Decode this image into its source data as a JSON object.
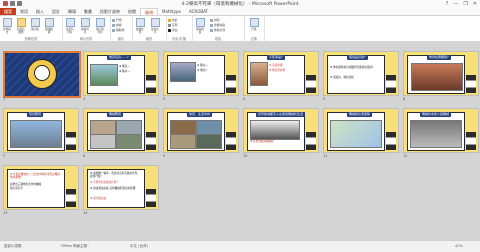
{
  "window": {
    "title": "4-2樂高不死車（環境和機械化） - Microsoft PowerPoint",
    "controls": [
      "?",
      "—",
      "❐",
      "✕"
    ]
  },
  "tabs": [
    {
      "label": "檔案",
      "kind": "file"
    },
    {
      "label": "常用",
      "kind": "normal"
    },
    {
      "label": "插入",
      "kind": "normal"
    },
    {
      "label": "設計",
      "kind": "normal"
    },
    {
      "label": "轉場",
      "kind": "normal"
    },
    {
      "label": "動畫",
      "kind": "normal"
    },
    {
      "label": "投影片放映",
      "kind": "normal"
    },
    {
      "label": "校閱",
      "kind": "normal"
    },
    {
      "label": "檢視",
      "kind": "active"
    },
    {
      "label": "Mathtype",
      "kind": "normal"
    },
    {
      "label": "ACROBAT",
      "kind": "normal"
    }
  ],
  "ribbon": {
    "groups": [
      {
        "label": "簡報檢視",
        "buttons": [
          "標準模式",
          "投影片瀏覽",
          "備忘稿",
          "閱讀檢視"
        ]
      },
      {
        "label": "母片檢視",
        "buttons": [
          "投影片母片",
          "講義母片",
          "備忘稿母片"
        ]
      },
      {
        "label": "顯示",
        "items": [
          "尺規",
          "格線",
          "輔助線"
        ]
      },
      {
        "label": "縮放",
        "buttons": [
          "縮放比例",
          "最適大小"
        ]
      },
      {
        "label": "色彩/灰階",
        "items": [
          "色彩",
          "灰階",
          "黑白"
        ]
      },
      {
        "label": "視窗",
        "buttons": [
          "開新視窗"
        ],
        "items": [
          "排列",
          "重疊視窗",
          "移動分割"
        ]
      },
      {
        "label": "巨集",
        "buttons": [
          "巨集"
        ]
      }
    ],
    "colors": {
      "color": "#e8a33a",
      "gray": "#8c8c8c",
      "bw": "#222222"
    }
  },
  "slides": [
    {
      "num": "1",
      "title": "",
      "body": [],
      "selected": true
    },
    {
      "num": "2",
      "title": "樂高玩具……?",
      "body": [
        "❖ 樂高→",
        "❖ 積木→"
      ],
      "selected": false
    },
    {
      "num": "3",
      "title": "",
      "body": [
        "❖ 積木→",
        "❖ 樂高?"
      ],
      "selected": false
    },
    {
      "num": "4",
      "title": "不死車是?",
      "body": [
        "❖ 自造無限",
        "❖ 樂高等材料"
      ],
      "selected": false
    },
    {
      "num": "5",
      "title": "環境是甚麼?",
      "body": [
        "❖ 你在那些地方接觸到什麼樣的環境?",
        "❖ 環境好、壞的比較"
      ],
      "selected": false
    },
    {
      "num": "6",
      "title": "你會在哪裡用?",
      "body": [],
      "selected": false
    },
    {
      "num": "7",
      "title": "環境應用",
      "body": [],
      "selected": false
    },
    {
      "num": "8",
      "title": "機械應用",
      "body": [],
      "selected": false
    },
    {
      "num": "9",
      "title": "常見、生活中的",
      "body": [],
      "selected": false
    },
    {
      "num": "10",
      "title": "世界各地都有人在使用機械化生活",
      "body": [
        "❖ 社會發展與機械化"
      ],
      "selected": false
    },
    {
      "num": "11",
      "title": "機械與交通運輸",
      "body": [],
      "selected": false
    },
    {
      "num": "12",
      "title": "機械化中的人與機械",
      "body": [],
      "selected": false
    },
    {
      "num": "13",
      "title": "",
      "body": [
        "❖ 什麼是機械化？日常當中哪些東西是機械化的產物？",
        "請舉出三種你生活中的機械",
        "與大家分享"
      ],
      "selected": false
    },
    {
      "num": "14",
      "title": "",
      "body": [
        "❖ 請想像一輛車，若是在沒有馬路的世界，如何行進？",
        "❖ 不死車的意義是什麼?",
        "❖ 請試著說說看 這些機械對環境的影響",
        "❖ 請分組討論"
      ],
      "selected": false
    }
  ],
  "status": {
    "left": "投影片瀏覽",
    "theme": "\"Office 佈景主題\"",
    "lang": "中文 (台灣)",
    "zoom": "42%"
  }
}
